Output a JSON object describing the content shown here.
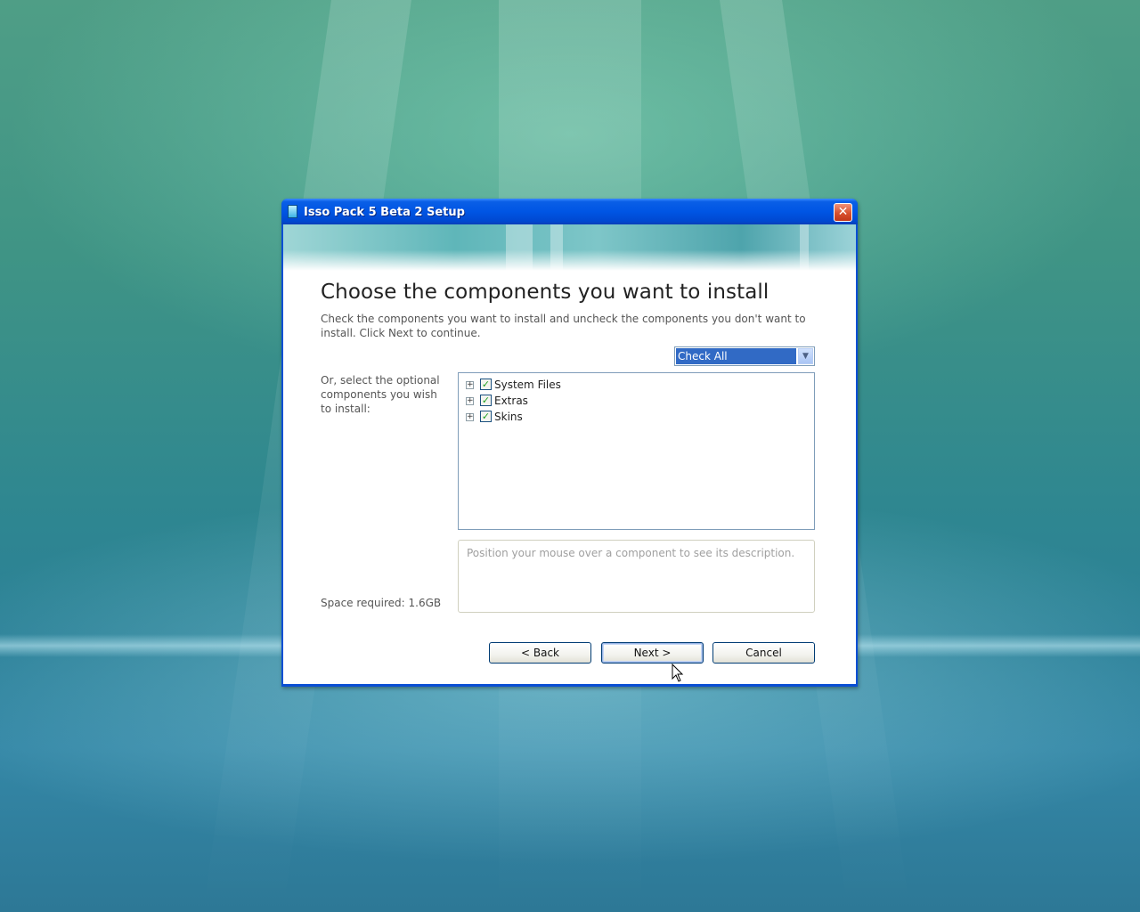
{
  "window": {
    "title": "Isso Pack 5 Beta 2 Setup",
    "close_glyph": "✕"
  },
  "page": {
    "heading": "Choose the components you want to install",
    "description": "Check the components you want to install and uncheck the components you don't want to install. Click Next to continue.",
    "install_type": {
      "selected": "Check All",
      "arrow_glyph": "▼"
    },
    "components_label": "Or, select the optional components you wish to install:",
    "components": [
      {
        "label": "System Files",
        "checked": true
      },
      {
        "label": "Extras",
        "checked": true
      },
      {
        "label": "Skins",
        "checked": true
      }
    ],
    "expander_glyph": "+",
    "check_glyph": "✓",
    "description_placeholder": "Position your mouse over a component to see its description.",
    "space_required": "Space required: 1.6GB"
  },
  "buttons": {
    "back": "< Back",
    "next": "Next >",
    "cancel": "Cancel"
  },
  "colors": {
    "titlebar": "#0055e4",
    "selection": "#316ac5",
    "close": "#d8502e"
  }
}
